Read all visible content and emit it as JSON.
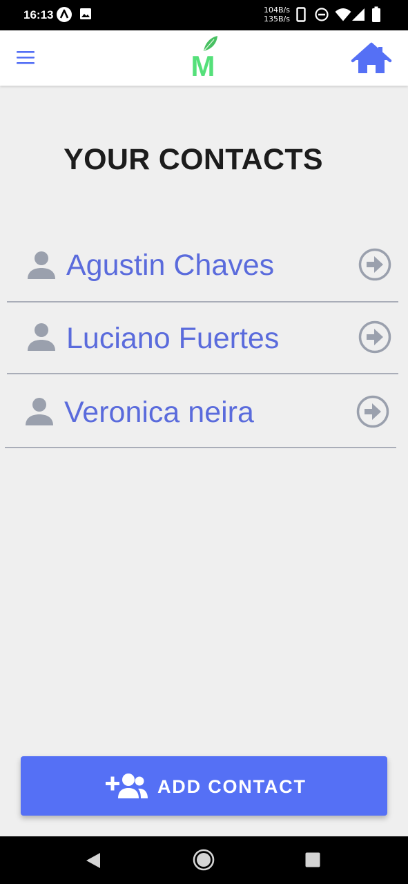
{
  "status_bar": {
    "time": "16:13",
    "net_down": "104B/s",
    "net_up": "135B/s",
    "icons": [
      "app-notification-icon",
      "image-notification-icon",
      "phone-icon",
      "do-not-disturb-icon",
      "wifi-icon",
      "cell-signal-icon",
      "battery-icon"
    ]
  },
  "app_bar": {
    "menu_icon": "hamburger-menu-icon",
    "logo_letter": "M",
    "home_icon": "home-icon"
  },
  "page": {
    "title": "YOUR CONTACTS"
  },
  "contacts": [
    {
      "name": "Agustin Chaves"
    },
    {
      "name": "Luciano Fuertes"
    },
    {
      "name": "Veronica neira"
    }
  ],
  "add_button": {
    "label": "ADD CONTACT",
    "icon": "add-user-icon"
  },
  "nav_bar": {
    "icons": [
      "back-icon",
      "home-circle-icon",
      "recents-icon"
    ]
  },
  "colors": {
    "accent": "#5570f5",
    "contact_text": "#5a6bdc",
    "icon_gray": "#9aa0ad",
    "logo_green": "#55e07a",
    "logo_leaf": "#48c062",
    "background": "#efefef"
  }
}
